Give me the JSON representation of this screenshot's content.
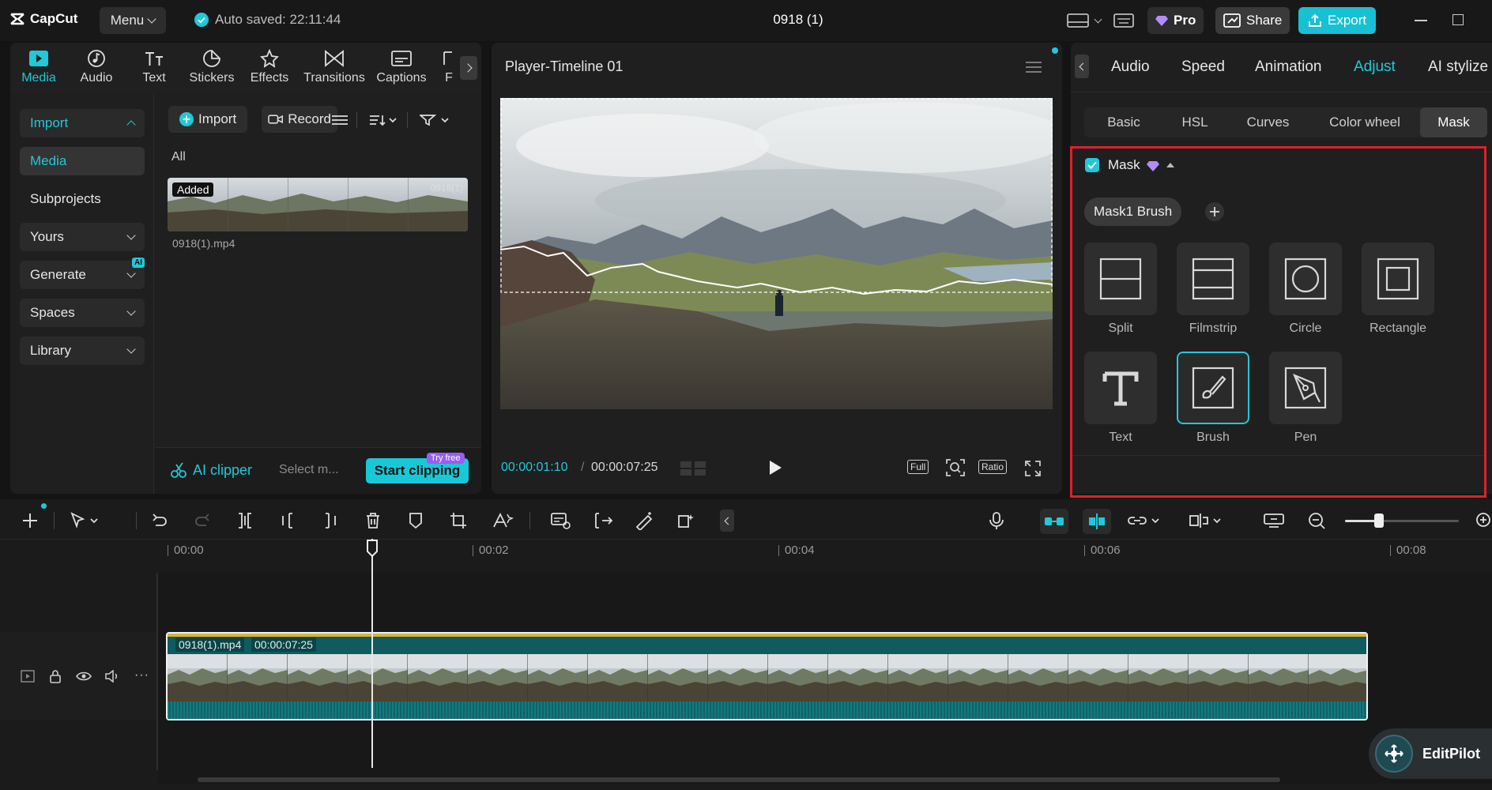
{
  "app": {
    "logo_text": "CapCut",
    "menu_label": "Menu",
    "autosave_text": "Auto saved: 22:11:44",
    "project_title": "0918 (1)",
    "pro_label": "Pro",
    "share_label": "Share",
    "export_label": "Export"
  },
  "toolbar": {
    "tabs": [
      {
        "label": "Media",
        "icon": "media-icon",
        "active": true
      },
      {
        "label": "Audio",
        "icon": "audio-icon"
      },
      {
        "label": "Text",
        "icon": "text-icon"
      },
      {
        "label": "Stickers",
        "icon": "stickers-icon"
      },
      {
        "label": "Effects",
        "icon": "effects-icon"
      },
      {
        "label": "Transitions",
        "icon": "transitions-icon"
      },
      {
        "label": "Captions",
        "icon": "captions-icon"
      },
      {
        "label": "F",
        "icon": "more-icon"
      }
    ]
  },
  "sidebar": {
    "items": [
      {
        "label": "Import",
        "expanded": true
      },
      {
        "label": "Media"
      },
      {
        "label": "Subprojects"
      },
      {
        "label": "Yours"
      },
      {
        "label": "Generate",
        "badge": "AI"
      },
      {
        "label": "Spaces"
      },
      {
        "label": "Library"
      }
    ]
  },
  "media": {
    "import_label": "Import",
    "record_label": "Record",
    "filter_all": "All",
    "clip_badge": "Added",
    "clip_corner": "0918(1)",
    "clip_name": "0918(1).mp4",
    "ai_clipper_label": "AI clipper",
    "select_placeholder": "Select m...",
    "start_clipping_label": "Start clipping",
    "try_free_badge": "Try free"
  },
  "player": {
    "title": "Player-Timeline 01",
    "current_time": "00:00:01:10",
    "total_time": "00:00:07:25",
    "full_label": "Full",
    "ratio_label": "Ratio"
  },
  "adjust": {
    "top_tabs": [
      "Audio",
      "Speed",
      "Animation",
      "Adjust",
      "AI stylize"
    ],
    "active_top_tab": "Adjust",
    "sub_tabs": [
      "Basic",
      "HSL",
      "Curves",
      "Color wheel",
      "Mask"
    ],
    "active_sub_tab": "Mask",
    "mask_header": "Mask",
    "mask_chip": "Mask1 Brush",
    "mask_types": [
      {
        "label": "Split",
        "icon": "split-mask-icon"
      },
      {
        "label": "Filmstrip",
        "icon": "filmstrip-mask-icon"
      },
      {
        "label": "Circle",
        "icon": "circle-mask-icon"
      },
      {
        "label": "Rectangle",
        "icon": "rectangle-mask-icon"
      },
      {
        "label": "Text",
        "icon": "text-mask-icon"
      },
      {
        "label": "Brush",
        "icon": "brush-mask-icon",
        "selected": true
      },
      {
        "label": "Pen",
        "icon": "pen-mask-icon"
      }
    ],
    "highlight_color": "#e0202a",
    "accent_color": "#21c8d8"
  },
  "timeline": {
    "ruler": [
      "00:00",
      "00:02",
      "00:04",
      "00:06",
      "00:08"
    ],
    "clip_name": "0918(1).mp4",
    "clip_duration": "00:00:07:25",
    "editpilot_label": "EditPilot"
  }
}
